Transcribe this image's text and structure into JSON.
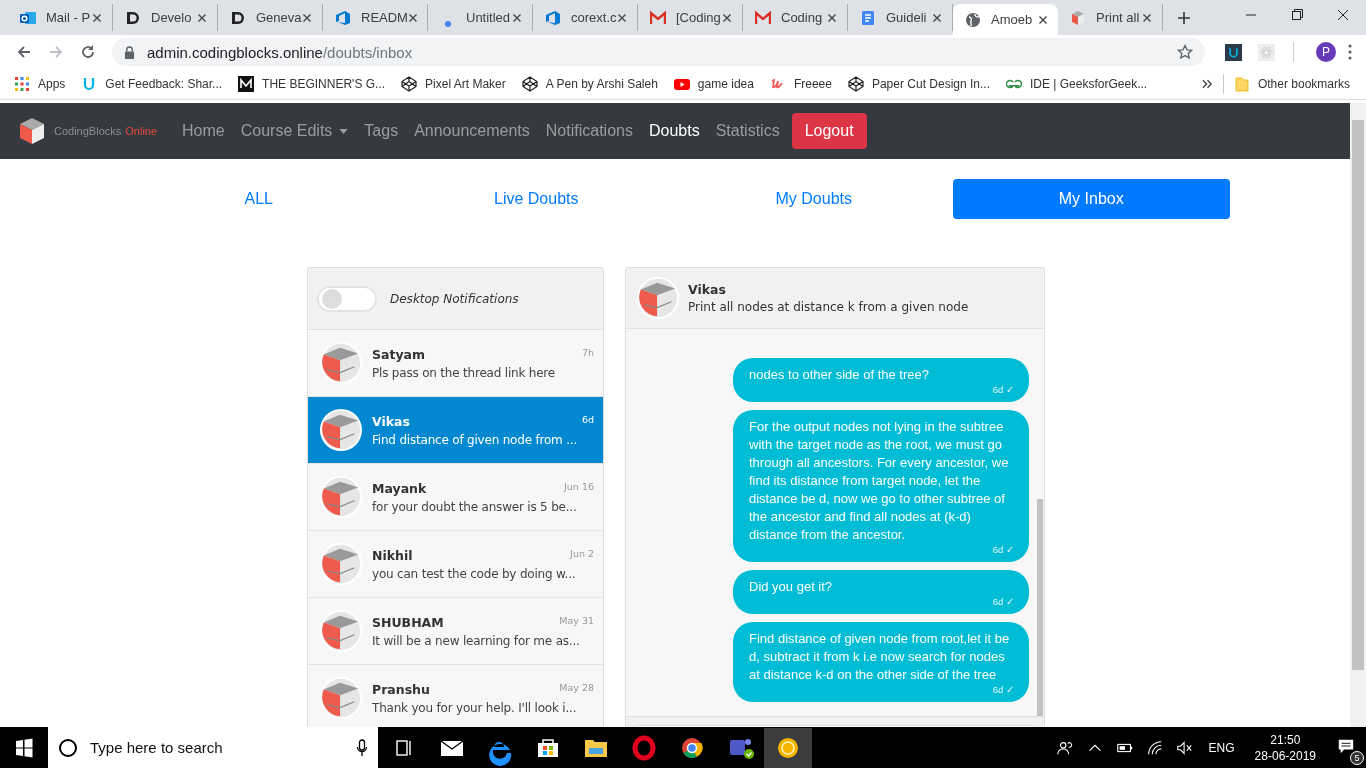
{
  "browser": {
    "tabs": [
      {
        "title": "Mail - P",
        "kind": "outlook",
        "selected": false
      },
      {
        "title": "Develo",
        "kind": "letter",
        "selected": false
      },
      {
        "title": "Geneva",
        "kind": "letter",
        "selected": false
      },
      {
        "title": "READM",
        "kind": "azure",
        "selected": false
      },
      {
        "title": "Untitled",
        "kind": "dot",
        "selected": false
      },
      {
        "title": "corext.c",
        "kind": "azure",
        "selected": false
      },
      {
        "title": "[Coding",
        "kind": "gmail",
        "selected": false
      },
      {
        "title": "Coding",
        "kind": "gmail",
        "selected": false
      },
      {
        "title": "Guideli",
        "kind": "docs",
        "selected": false
      },
      {
        "title": "Amoeb",
        "kind": "globe",
        "selected": true
      },
      {
        "title": "Print all",
        "kind": "cube",
        "selected": false
      }
    ],
    "url_host": "admin.codingblocks.online",
    "url_path": "/doubts/inbox",
    "profile_initial": "P",
    "bookmarks": [
      {
        "label": "Apps",
        "kind": "apps"
      },
      {
        "label": "Get Feedback: Shar...",
        "kind": "udacity"
      },
      {
        "label": "THE BEGINNER'S G...",
        "kind": "medium"
      },
      {
        "label": "Pixel Art Maker",
        "kind": "codepen"
      },
      {
        "label": "A Pen by Arshi Saleh",
        "kind": "codepen"
      },
      {
        "label": "game idea",
        "kind": "youtube"
      },
      {
        "label": "Freeee",
        "kind": "freeee"
      },
      {
        "label": "Paper Cut Design In...",
        "kind": "codepen"
      },
      {
        "label": "IDE | GeeksforGeek...",
        "kind": "geeks"
      }
    ],
    "other_bookmarks": "Other bookmarks"
  },
  "site": {
    "brand": "CodingBlocks",
    "brand_suffix": "Online",
    "nav": [
      {
        "label": "Home",
        "selected": false,
        "dropdown": false
      },
      {
        "label": "Course Edits",
        "selected": false,
        "dropdown": true
      },
      {
        "label": "Tags",
        "selected": false,
        "dropdown": false
      },
      {
        "label": "Announcements",
        "selected": false,
        "dropdown": false
      },
      {
        "label": "Notifications",
        "selected": false,
        "dropdown": false
      },
      {
        "label": "Doubts",
        "selected": true,
        "dropdown": false
      },
      {
        "label": "Statistics",
        "selected": false,
        "dropdown": false
      }
    ],
    "logout": "Logout"
  },
  "filter_tabs": [
    {
      "label": "ALL",
      "selected": false
    },
    {
      "label": "Live Doubts",
      "selected": false
    },
    {
      "label": "My Doubts",
      "selected": false
    },
    {
      "label": "My Inbox",
      "selected": true
    }
  ],
  "inbox": {
    "notifications_label": "Desktop Notifications",
    "notifications_on": false,
    "threads": [
      {
        "name": "Satyam",
        "preview": "Pls pass on the thread link here",
        "time": "7h",
        "selected": false
      },
      {
        "name": "Vikas",
        "preview": "Find distance of given node from ...",
        "time": "6d",
        "selected": true
      },
      {
        "name": "Mayank",
        "preview": "for your doubt the answer is 5 be...",
        "time": "Jun 16",
        "selected": false
      },
      {
        "name": "Nikhil",
        "preview": "you can test the code by doing w...",
        "time": "Jun 2",
        "selected": false
      },
      {
        "name": "SHUBHAM",
        "preview": "It will be a new learning for me as...",
        "time": "May 31",
        "selected": false
      },
      {
        "name": "Pranshu",
        "preview": "Thank you for your help. I'll look i...",
        "time": "May 28",
        "selected": false
      }
    ]
  },
  "chat": {
    "name": "Vikas",
    "subject": "Print all nodes at distance k from a given node",
    "messages": [
      {
        "text": "nodes to other side of the tree?",
        "time": "6d ✓"
      },
      {
        "text": "For the output nodes not lying in the subtree with the target node as the root, we must go through all ancestors. For every ancestor, we find its distance from target node, let the distance be d, now we go to other subtree of the ancestor and find all nodes at (k-d) distance from the ancestor.",
        "time": "6d ✓"
      },
      {
        "text": "Did you get it?",
        "time": "6d ✓"
      },
      {
        "text": "Find distance of given node from root,let it be d, subtract it from k i.e now search for nodes at distance k-d on the other side of the tree",
        "time": "6d ✓"
      }
    ]
  },
  "taskbar": {
    "search_placeholder": "Type here to search",
    "language": "ENG",
    "time": "21:50",
    "date": "28-06-2019",
    "notification_count": "5"
  }
}
